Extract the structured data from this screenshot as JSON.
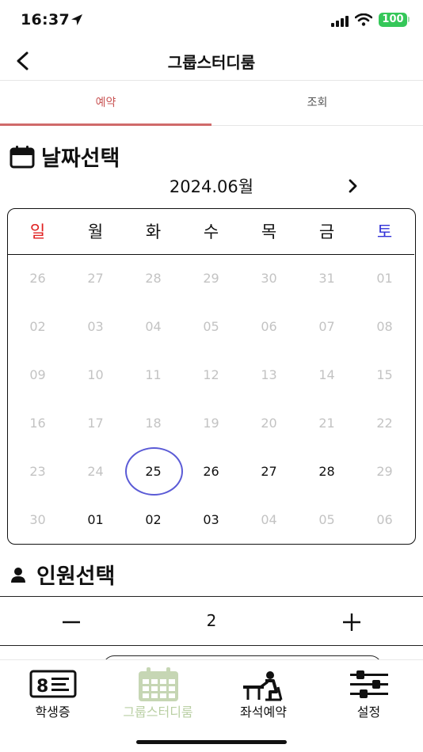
{
  "status_bar": {
    "time": "16:37",
    "battery": "100"
  },
  "header": {
    "title": "그룹스터디룸"
  },
  "tabs": [
    {
      "label": "예약",
      "active": true
    },
    {
      "label": "조회",
      "active": false
    }
  ],
  "date_section": {
    "title": "날짜선택",
    "month_label": "2024.06월"
  },
  "calendar": {
    "weekdays": [
      "일",
      "월",
      "화",
      "수",
      "목",
      "금",
      "토"
    ],
    "weekday_colors": {
      "sunday": "#e02020",
      "saturday": "#3030d8",
      "default": "#111111"
    },
    "weeks": [
      [
        "26",
        "27",
        "28",
        "29",
        "30",
        "31",
        "01"
      ],
      [
        "02",
        "03",
        "04",
        "05",
        "06",
        "07",
        "08"
      ],
      [
        "09",
        "10",
        "11",
        "12",
        "13",
        "14",
        "15"
      ],
      [
        "16",
        "17",
        "18",
        "19",
        "20",
        "21",
        "22"
      ],
      [
        "23",
        "24",
        "25",
        "26",
        "27",
        "28",
        "29"
      ],
      [
        "30",
        "01",
        "02",
        "03",
        "04",
        "05",
        "06"
      ]
    ],
    "selected_day": "25",
    "selection_color": "#5b5bd6"
  },
  "people_section": {
    "title": "인원선택",
    "count": "2",
    "decrement_icon": "minus-icon",
    "increment_icon": "plus-icon"
  },
  "bottom_nav": [
    {
      "label": "학생증",
      "icon": "student-id-icon",
      "active": false
    },
    {
      "label": "그룹스터디룸",
      "icon": "calendar-icon",
      "active": true
    },
    {
      "label": "좌석예약",
      "icon": "seat-study-icon",
      "active": false
    },
    {
      "label": "설정",
      "icon": "settings-sliders-icon",
      "active": false
    }
  ],
  "colors": {
    "tab_active": "#c95555",
    "nav_active": "#b9cfa3"
  }
}
